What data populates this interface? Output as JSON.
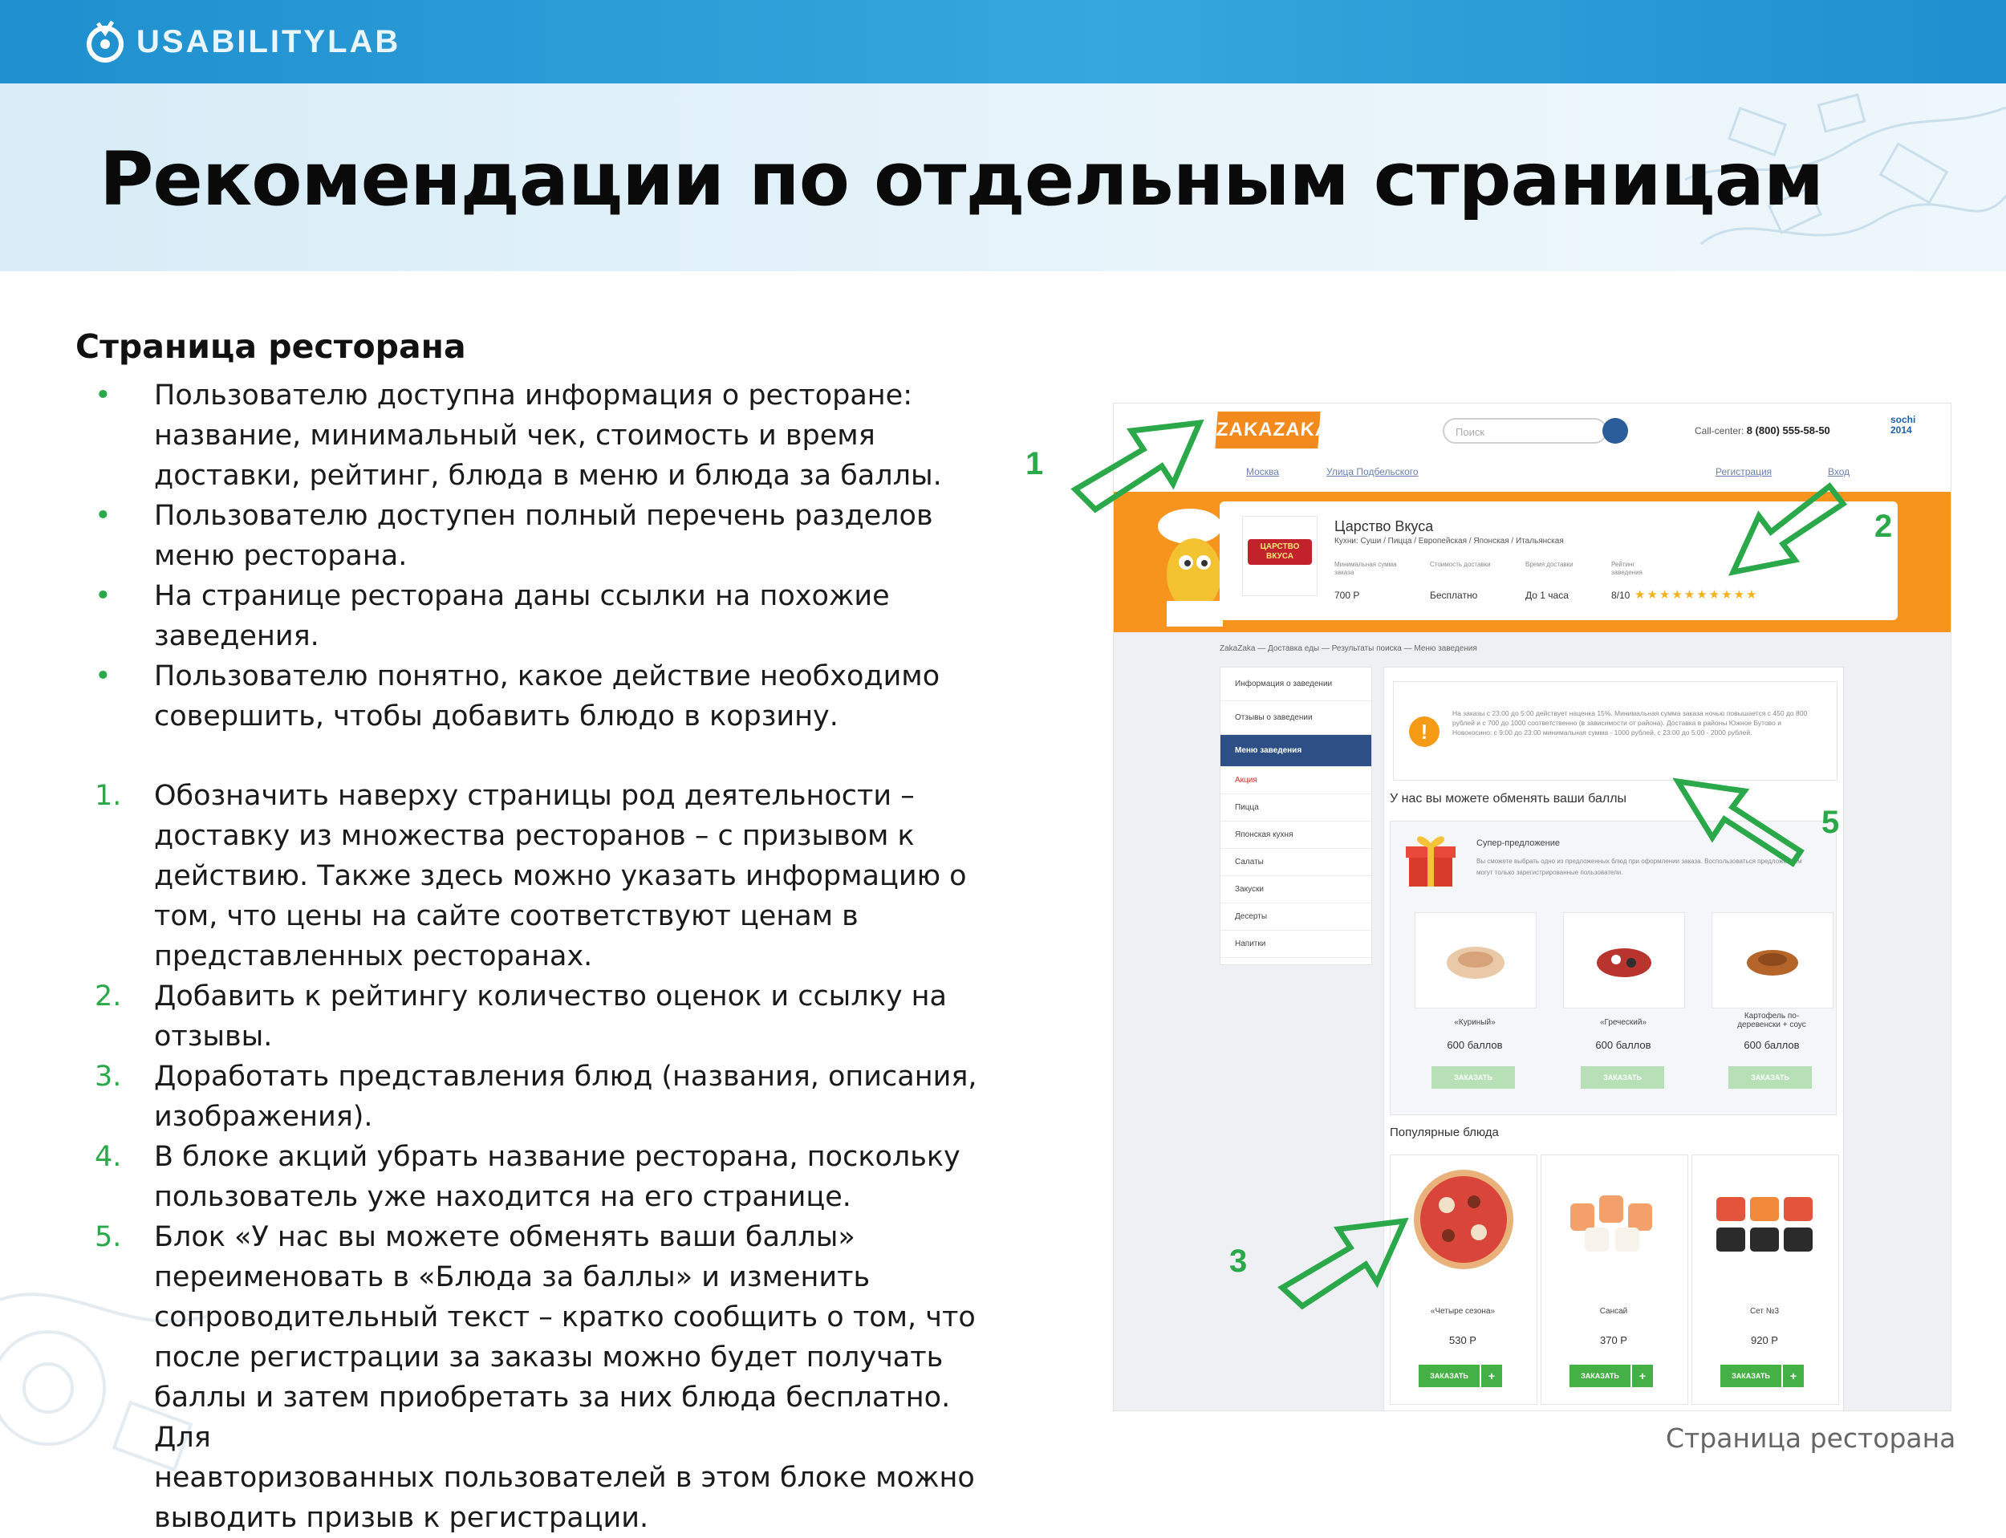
{
  "header": {
    "logo_text": "USABILITYLAB",
    "title": "Рекомендации по отдельным страницам"
  },
  "section_heading": "Страница ресторана",
  "bullets": [
    [
      "Пользователю доступна информация о ресторане:",
      "название, минимальный чек, стоимость и время",
      "доставки, рейтинг, блюда в меню и блюда за баллы."
    ],
    [
      "Пользователю доступен полный перечень разделов",
      "меню ресторана."
    ],
    [
      "На странице ресторана даны ссылки на похожие",
      "заведения."
    ],
    [
      "Пользователю понятно, какое действие необходимо",
      "совершить, чтобы добавить блюдо в корзину."
    ]
  ],
  "recommendations": [
    {
      "num": "1.",
      "lines": [
        "Обозначить наверху страницы род деятельности –",
        "доставку из множества ресторанов – с призывом к",
        "действию. Также здесь можно указать информацию о",
        "том, что цены на сайте соответствуют ценам в",
        "представленных ресторанах."
      ]
    },
    {
      "num": "2.",
      "lines": [
        "Добавить к рейтингу количество оценок и ссылку на",
        "отзывы."
      ]
    },
    {
      "num": "3.",
      "lines": [
        "Доработать представления блюд (названия, описания,",
        "изображения)."
      ]
    },
    {
      "num": "4.",
      "lines": [
        "В блоке акций убрать название ресторана, поскольку",
        "пользователь уже находится на его странице."
      ]
    },
    {
      "num": "5.",
      "lines": [
        "Блок «У нас вы можете обменять ваши баллы»",
        "переименовать в «Блюда за баллы» и изменить",
        "сопроводительный текст – кратко сообщить о том, что",
        "после регистрации за заказы можно будет получать",
        "баллы и затем приобретать за них блюда бесплатно. Для",
        "неавторизованных пользователей в этом блоке можно",
        "выводить призыв к регистрации."
      ]
    }
  ],
  "screenshot": {
    "brand": "ZAKAZAKA",
    "search_placeholder": "Поиск",
    "call_center_label": "Call-center:",
    "call_center_phone": "8 (800) 555-58-50",
    "sochi": "sochi 2014",
    "city": "Москва",
    "street": "Улица Подбельского",
    "register": "Регистрация",
    "login": "Вход",
    "restaurant_logo": "ЦАРСТВО ВКУСА",
    "restaurant_name": "Царство Вкуса",
    "kitchen": "Кухни: Суши / Пицца / Европейская / Японская / Итальянская",
    "stats": [
      {
        "label": "Минимальная сумма заказа",
        "value": "700 Р"
      },
      {
        "label": "Стоимость доставки",
        "value": "Бесплатно"
      },
      {
        "label": "Время доставки",
        "value": "До 1 часа"
      },
      {
        "label": "Рейтинг заведения",
        "value": "8/10"
      }
    ],
    "rating_stars": "★★★★★★★★★★",
    "breadcrumbs": "ZakaZaka — Доставка еды — Результаты поиска — Меню заведения",
    "sidebar": [
      "Информация о заведении",
      "Отзывы о заведении",
      "Меню заведения",
      "Акция",
      "Пицца",
      "Японская кухня",
      "Салаты",
      "Закуски",
      "Десерты",
      "Напитки"
    ],
    "notice": "На заказы с 23:00 до 5:00 действует наценка 15%. Минимальная сумма заказа ночью повышается с 450 до 800 рублей и с 700 до 1000 соответственно (в зависимости от района). Доставка в районы Южное Бутово и Новокосино: с 9:00 до 23:00 минимальная сумма - 1000 рублей, с 23:00 до 5:00 - 2000 рублей.",
    "points_title": "У нас вы можете обменять ваши баллы",
    "promo_title": "Супер-предложение",
    "promo_text": "Вы сможете выбрать одно из предложенных блюд при оформлении заказа. Воспользоваться предложением могут только зарегистрированные пользователи.",
    "points_dishes": [
      {
        "name": "«Куриный»",
        "price": "600 баллов"
      },
      {
        "name": "«Греческий»",
        "price": "600 баллов"
      },
      {
        "name": "Картофель по-деревенски + соус",
        "price": "600 баллов"
      }
    ],
    "order_label": "ЗАКАЗАТЬ",
    "popular_title": "Популярные блюда",
    "popular_dishes": [
      {
        "name": "«Четыре сезона»",
        "price": "530 Р"
      },
      {
        "name": "Сансай",
        "price": "370 Р"
      },
      {
        "name": "Сет №3",
        "price": "920 Р"
      }
    ],
    "plus": "+"
  },
  "callouts": [
    "1",
    "2",
    "3",
    "5"
  ],
  "caption": "Страница ресторана",
  "colors": {
    "accent_green": "#2aa84a",
    "header_blue": "#1f8fcf",
    "zakazaka_orange": "#f7941d"
  }
}
